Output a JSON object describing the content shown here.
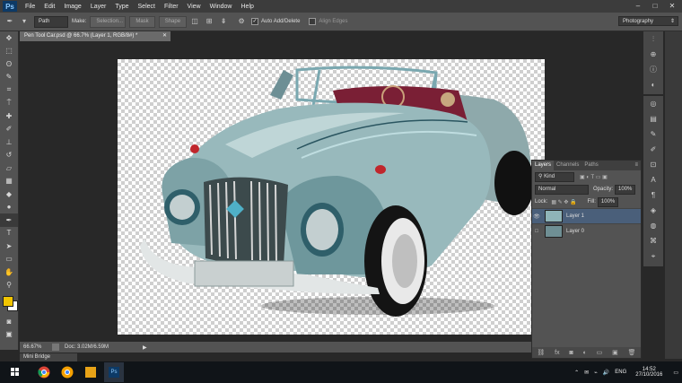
{
  "app": {
    "logo": "Ps"
  },
  "menu": [
    "File",
    "Edit",
    "Image",
    "Layer",
    "Type",
    "Select",
    "Filter",
    "View",
    "Window",
    "Help"
  ],
  "window_controls": {
    "minimize": "–",
    "maximize": "□",
    "close": "✕"
  },
  "options": {
    "mode": "Path",
    "make_label": "Make:",
    "selection_btn": "Selection...",
    "mask_btn": "Mask",
    "shape_btn": "Shape",
    "auto_add_delete": "Auto Add/Delete",
    "align_edges": "Align Edges",
    "workspace": "Photography"
  },
  "document": {
    "tab_title": "Pen Tool Car.psd @ 66.7% (Layer 1, RGB/8#) *",
    "zoom": "66.67%",
    "doc_size": "Doc: 3.02M/6.59M"
  },
  "mini_bridge": "Mini Bridge",
  "layers_panel": {
    "tabs": [
      "Layers",
      "Channels",
      "Paths"
    ],
    "kind": "Kind",
    "blend_mode": "Normal",
    "opacity_label": "Opacity:",
    "opacity": "100%",
    "lock_label": "Lock:",
    "fill_label": "Fill:",
    "fill": "100%",
    "layers": [
      {
        "name": "Layer 1",
        "selected": true
      },
      {
        "name": "Layer 0",
        "selected": false
      }
    ]
  },
  "taskbar": {
    "lang": "ENG",
    "time": "14:52",
    "date": "27/10/2016"
  },
  "colors": {
    "foreground": "#f2c500",
    "background": "#ffffff",
    "car_body": "#8fb4b8",
    "photoshop_blue": "#0d3a66"
  },
  "icons": {
    "tools": [
      "move",
      "marquee",
      "lasso",
      "quick-select",
      "crop",
      "eyedropper",
      "healing",
      "brush",
      "clone-stamp",
      "history-brush",
      "eraser",
      "gradient",
      "blur",
      "dodge",
      "pen",
      "type",
      "path-select",
      "rectangle",
      "hand",
      "zoom"
    ]
  }
}
